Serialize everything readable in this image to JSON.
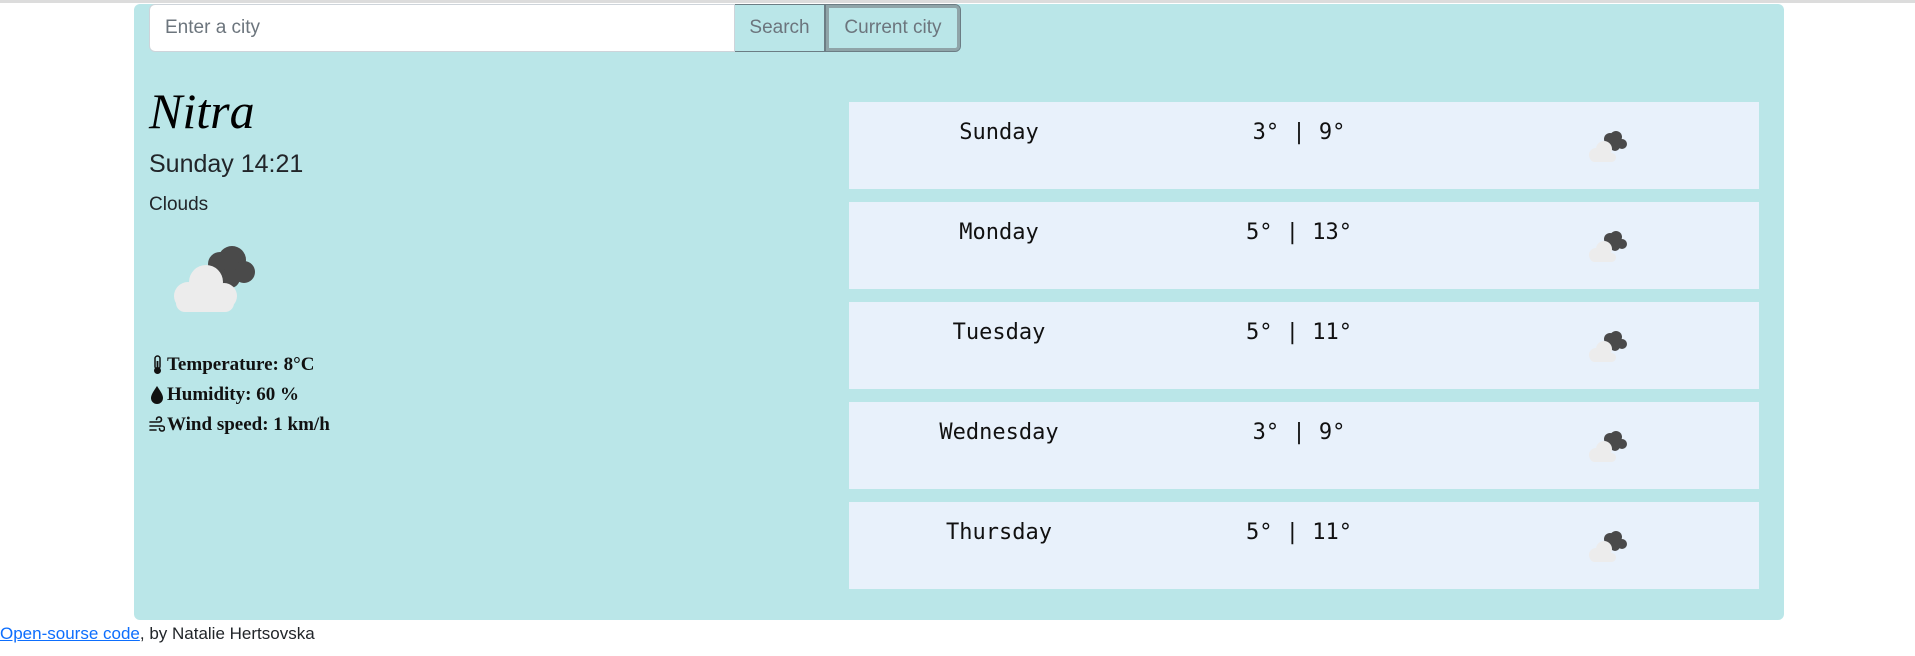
{
  "search": {
    "placeholder": "Enter a city",
    "value": ""
  },
  "buttons": {
    "search_label": "Search",
    "current_label": "Current city"
  },
  "current": {
    "city": "Nitra",
    "datetime": "Sunday 14:21",
    "description": "Clouds",
    "icon": "broken-clouds-icon",
    "temperature_text": "Temperature: 8°C",
    "humidity_text": "Humidity: 60 %",
    "wind_text": "Wind speed: 1 km/h"
  },
  "forecast": [
    {
      "day": "Sunday",
      "temps": "3° | 9°",
      "icon": "broken-clouds-icon"
    },
    {
      "day": "Monday",
      "temps": "5° | 13°",
      "icon": "broken-clouds-icon"
    },
    {
      "day": "Tuesday",
      "temps": "5° | 11°",
      "icon": "broken-clouds-icon"
    },
    {
      "day": "Wednesday",
      "temps": "3° | 9°",
      "icon": "broken-clouds-icon"
    },
    {
      "day": "Thursday",
      "temps": "5° | 11°",
      "icon": "broken-clouds-icon"
    }
  ],
  "footer": {
    "link_text": "Open-sourse code",
    "suffix": ", by Natalie Hertsovska"
  },
  "colors": {
    "panel": "#bae6e8",
    "forecast_row": "#e8f1fb",
    "link": "#0d6efd"
  }
}
